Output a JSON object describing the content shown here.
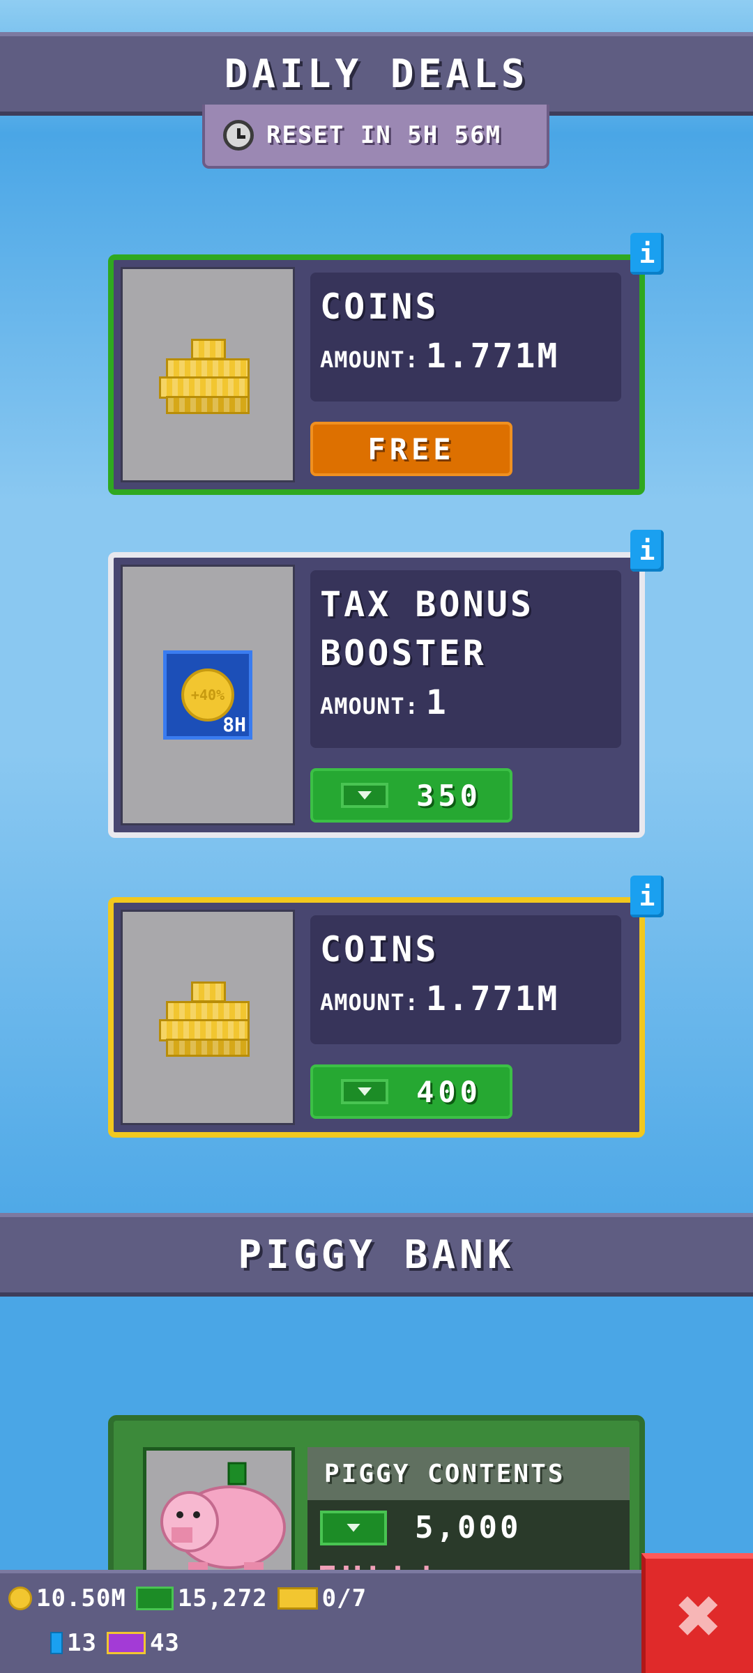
{
  "header": {
    "title": "DAILY DEALS",
    "reset_label": "RESET IN 5H 56M",
    "clock_icon": "clock-icon"
  },
  "deals": [
    {
      "title": "COINS",
      "amount_label": "AMOUNT:",
      "amount_value": "1.771M",
      "button_label": "FREE",
      "border_color": "#2fa820"
    },
    {
      "title_line1": "TAX BONUS",
      "title_line2": "BOOSTER",
      "amount_label": "AMOUNT:",
      "amount_value": "1",
      "price": "350",
      "badge_text": "8H",
      "coin_text": "+40%",
      "border_color": "#e8e8ee"
    },
    {
      "title": "COINS",
      "amount_label": "AMOUNT:",
      "amount_value": "1.771M",
      "price": "400",
      "border_color": "#f2c81e"
    }
  ],
  "info_badge": "i",
  "piggy": {
    "title": "PIGGY BANK",
    "contents_label": "PIGGY CONTENTS",
    "cash_value": "5,000",
    "status": "FULL!"
  },
  "resources": {
    "coins": "10.50M",
    "cash": "15,272",
    "tickets": "0/7",
    "gems": "13",
    "premium_tickets": "43"
  },
  "close_label": "✖"
}
